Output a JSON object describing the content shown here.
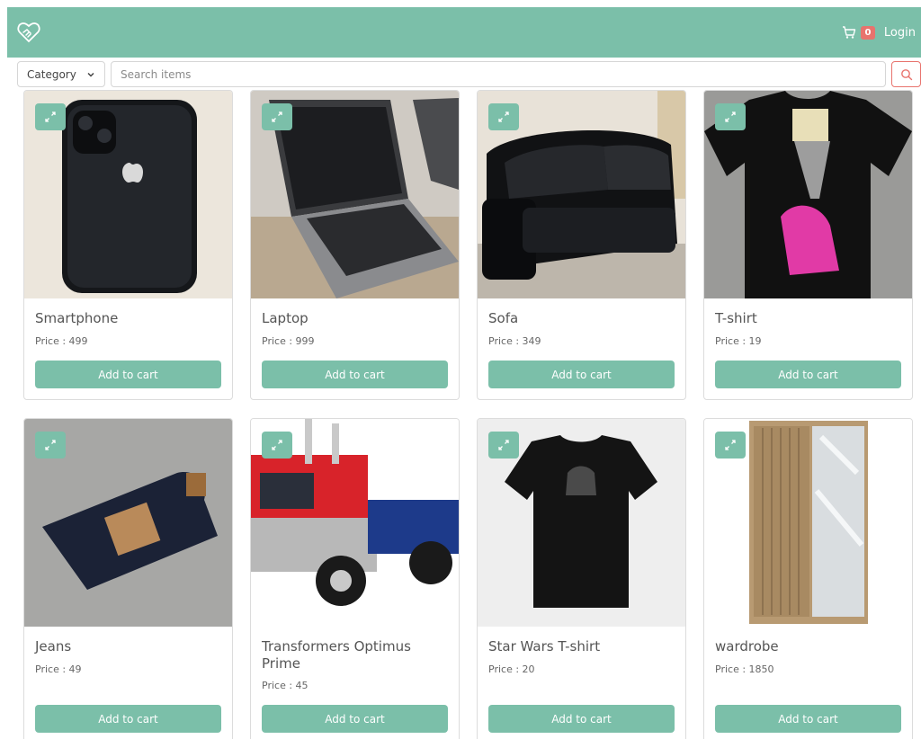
{
  "header": {
    "logo_icon": "handshake-heart-icon",
    "cart_icon": "shopping-cart-icon",
    "cart_count": "0",
    "login_label": "Login",
    "colors": {
      "primary": "#7bbfa9",
      "badge": "#e8736d"
    }
  },
  "search": {
    "category_label": "Category",
    "placeholder": "Search items",
    "value": "",
    "button_icon": "search-icon"
  },
  "products": [
    {
      "name": "Smartphone",
      "price": "Price : 499",
      "button": "Add to cart",
      "image": "smartphone-photo"
    },
    {
      "name": "Laptop",
      "price": "Price : 999",
      "button": "Add to cart",
      "image": "laptop-photo"
    },
    {
      "name": "Sofa",
      "price": "Price : 349",
      "button": "Add to cart",
      "image": "sofa-photo"
    },
    {
      "name": "T-shirt",
      "price": "Price : 19",
      "button": "Add to cart",
      "image": "tshirt-photo"
    },
    {
      "name": "Jeans",
      "price": "Price : 49",
      "button": "Add to cart",
      "image": "jeans-photo"
    },
    {
      "name": "Transformers Optimus Prime",
      "price": "Price : 45",
      "button": "Add to cart",
      "image": "toy-truck-photo"
    },
    {
      "name": "Star Wars T-shirt",
      "price": "Price : 20",
      "button": "Add to cart",
      "image": "starwars-tshirt-photo"
    },
    {
      "name": "wardrobe",
      "price": "Price : 1850",
      "button": "Add to cart",
      "image": "wardrobe-photo"
    }
  ]
}
